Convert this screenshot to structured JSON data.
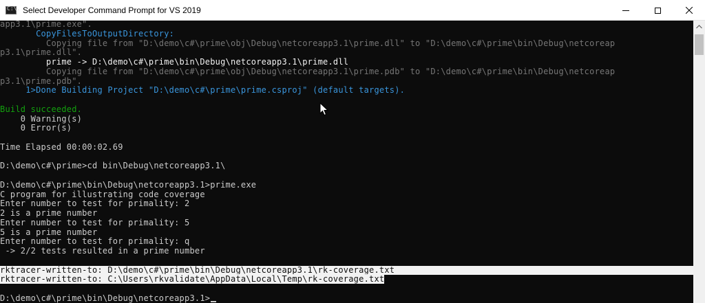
{
  "window": {
    "title": "Select Developer Command Prompt for VS 2019",
    "icon": "cmd-prompt-icon",
    "icon_text": "C:\\."
  },
  "controls": {
    "minimize": "minimize-icon",
    "maximize": "maximize-icon",
    "close": "close-icon"
  },
  "console": {
    "lines": [
      "app3.1\\prime.exe\".",
      "       CopyFilesToOutputDirectory:",
      "         Copying file from \"D:\\demo\\c#\\prime\\obj\\Debug\\netcoreapp3.1\\prime.dll\" to \"D:\\demo\\c#\\prime\\bin\\Debug\\netcoreap",
      "p3.1\\prime.dll\".",
      "         prime -> D:\\demo\\c#\\prime\\bin\\Debug\\netcoreapp3.1\\prime.dll",
      "         Copying file from \"D:\\demo\\c#\\prime\\obj\\Debug\\netcoreapp3.1\\prime.pdb\" to \"D:\\demo\\c#\\prime\\bin\\Debug\\netcoreap",
      "p3.1\\prime.pdb\".",
      "     1>Done Building Project \"D:\\demo\\c#\\prime\\prime.csproj\" (default targets).",
      "",
      "Build succeeded.",
      "    0 Warning(s)",
      "    0 Error(s)",
      "",
      "Time Elapsed 00:00:02.69",
      "",
      "D:\\demo\\c#\\prime>cd bin\\Debug\\netcoreapp3.1\\",
      "",
      "D:\\demo\\c#\\prime\\bin\\Debug\\netcoreapp3.1>prime.exe",
      "C program for illustrating code coverage",
      "Enter number to test for primality: 2",
      "2 is a prime number",
      "Enter number to test for primality: 5",
      "5 is a prime number",
      "Enter number to test for primality: q",
      " -> 2/2 tests resulted in a prime number",
      "",
      "rktracer-written-to: D:\\demo\\c#\\prime\\bin\\Debug\\netcoreapp3.1\\rk-coverage.txt",
      "rktracer-written-to: C:\\Users\\rkvalidate\\AppData\\Local\\Temp\\rk-coverage.txt",
      "",
      "D:\\demo\\c#\\prime\\bin\\Debug\\netcoreapp3.1>"
    ]
  },
  "colors": {
    "background": "#0c0c0c",
    "default_text": "#cccccc",
    "gray_text": "#767676",
    "cyan_text": "#3a96dd",
    "green_text": "#13a10e",
    "selection_bg": "#f2f2f2"
  }
}
